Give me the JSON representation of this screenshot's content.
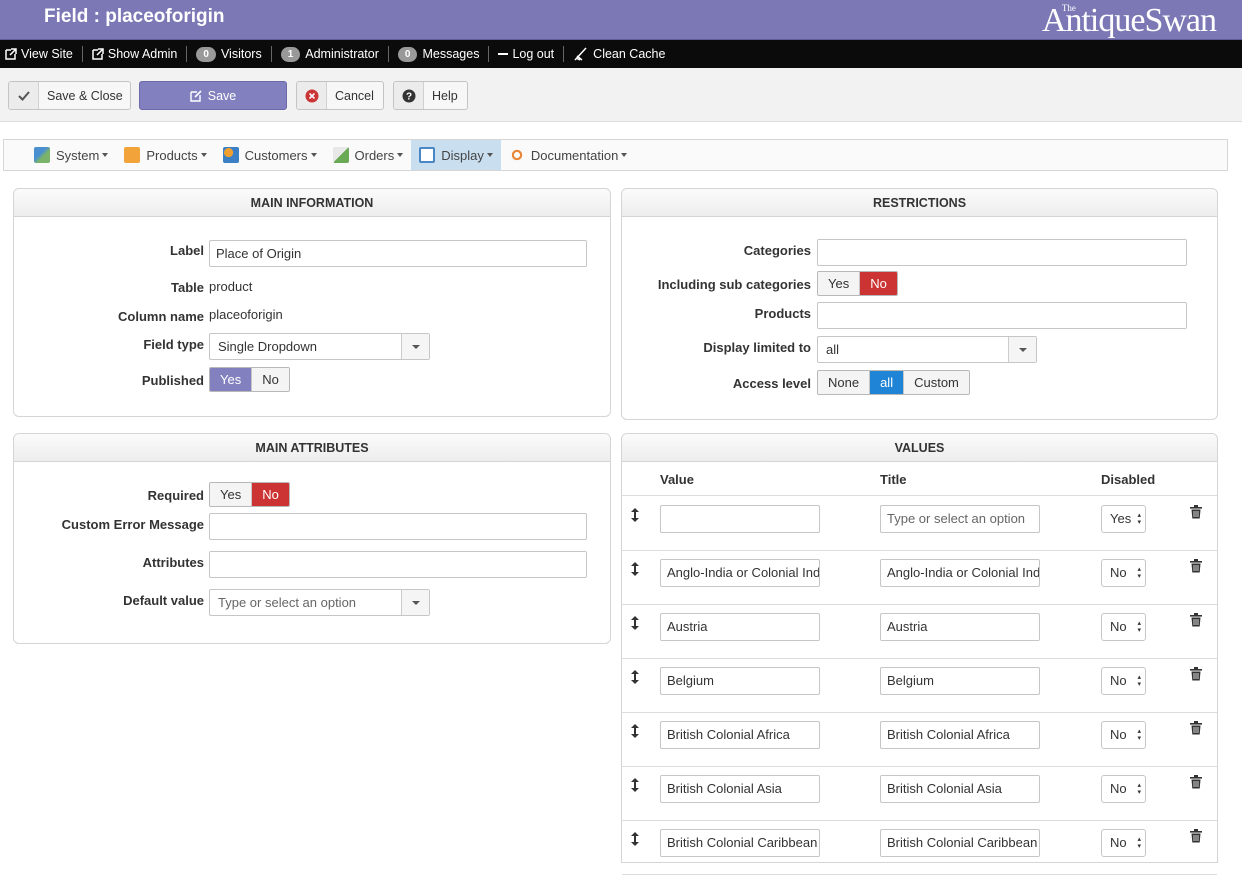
{
  "header": {
    "title": "Field : placeoforigin",
    "logo": {
      "the": "The",
      "main": "AntiqueSwan"
    }
  },
  "adminbar": {
    "view_site": "View Site",
    "show_admin": "Show Admin",
    "visitors_count": "0",
    "visitors_label": "Visitors",
    "admin_count": "1",
    "admin_label": "Administrator",
    "messages_count": "0",
    "messages_label": "Messages",
    "logout": "Log out",
    "clean_cache": "Clean Cache"
  },
  "toolbar": {
    "save_close": "Save & Close",
    "save": "Save",
    "cancel": "Cancel",
    "help": "Help"
  },
  "menu": {
    "items": [
      "System",
      "Products",
      "Customers",
      "Orders",
      "Display",
      "Documentation"
    ],
    "active": "Display"
  },
  "main_information": {
    "heading": "MAIN INFORMATION",
    "label_label": "Label",
    "label_value": "Place of Origin",
    "table_label": "Table",
    "table_value": "product",
    "column_label": "Column name",
    "column_value": "placeoforigin",
    "field_type_label": "Field type",
    "field_type_value": "Single Dropdown",
    "published_label": "Published",
    "published_yes": "Yes",
    "published_no": "No",
    "published_selected": "Yes"
  },
  "restrictions": {
    "heading": "RESTRICTIONS",
    "categories_label": "Categories",
    "sub_categories_label": "Including sub categories",
    "sub_yes": "Yes",
    "sub_no": "No",
    "sub_selected": "No",
    "products_label": "Products",
    "display_limited_label": "Display limited to",
    "display_limited_value": "all",
    "access_level_label": "Access level",
    "access_options": [
      "None",
      "all",
      "Custom"
    ],
    "access_selected": "all"
  },
  "main_attributes": {
    "heading": "MAIN ATTRIBUTES",
    "required_label": "Required",
    "required_yes": "Yes",
    "required_no": "No",
    "required_selected": "No",
    "custom_error_label": "Custom Error Message",
    "custom_error_value": "",
    "attributes_label": "Attributes",
    "attributes_value": "",
    "default_value_label": "Default value",
    "default_value_placeholder": "Type or select an option"
  },
  "values": {
    "heading": "VALUES",
    "col_value": "Value",
    "col_title": "Title",
    "col_disabled": "Disabled",
    "title_placeholder": "Type or select an option",
    "rows": [
      {
        "value": "",
        "title": "",
        "disabled": "Yes"
      },
      {
        "value": "Anglo-India or Colonial India",
        "title": " Anglo-India or Colonial India",
        "disabled": "No"
      },
      {
        "value": "Austria",
        "title": "Austria",
        "disabled": "No"
      },
      {
        "value": "Belgium",
        "title": "Belgium",
        "disabled": "No"
      },
      {
        "value": "British Colonial Africa",
        "title": "British Colonial Africa",
        "disabled": "No"
      },
      {
        "value": "British Colonial Asia",
        "title": "British Colonial Asia",
        "disabled": "No"
      },
      {
        "value": "British Colonial Caribbean",
        "title": "British Colonial Caribbean",
        "disabled": "No"
      }
    ]
  },
  "colors": {
    "header_bg": "#7b78b5",
    "primary": "#8280bf",
    "danger": "#cc3333",
    "active_blue": "#1f84d6",
    "menu_active": "#c9dff0"
  }
}
